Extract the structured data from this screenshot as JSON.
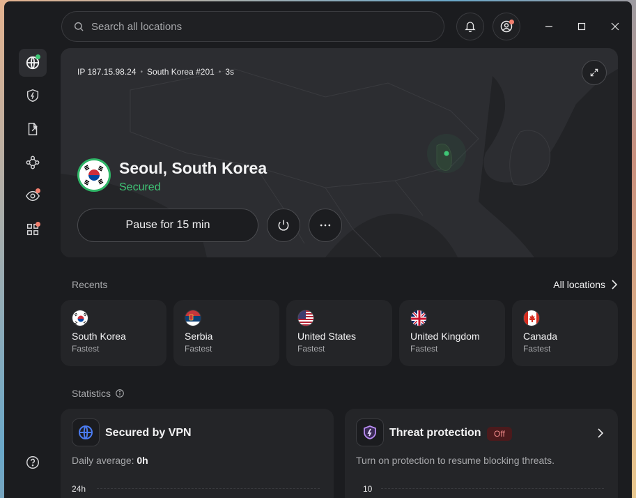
{
  "search": {
    "placeholder": "Search all locations"
  },
  "connection": {
    "ip": "IP 187.15.98.24",
    "server": "South Korea #201",
    "duration": "3s",
    "city": "Seoul, South Korea",
    "status": "Secured",
    "pause_label": "Pause for 15 min"
  },
  "recents": {
    "title": "Recents",
    "all_locations": "All locations",
    "items": [
      {
        "name": "South Korea",
        "sub": "Fastest"
      },
      {
        "name": "Serbia",
        "sub": "Fastest"
      },
      {
        "name": "United States",
        "sub": "Fastest"
      },
      {
        "name": "United Kingdom",
        "sub": "Fastest"
      },
      {
        "name": "Canada",
        "sub": "Fastest"
      }
    ]
  },
  "statistics": {
    "title": "Statistics",
    "vpn": {
      "title": "Secured by VPN",
      "avg_label": "Daily average: ",
      "avg_value": "0h",
      "axis_top": "24h"
    },
    "threat": {
      "title": "Threat protection",
      "badge": "Off",
      "desc": "Turn on protection to resume blocking threats.",
      "axis_top": "10"
    }
  },
  "colors": {
    "accent_green": "#3fc776",
    "badge_red": "#f08a8a",
    "dot_red": "#f27f6e"
  }
}
